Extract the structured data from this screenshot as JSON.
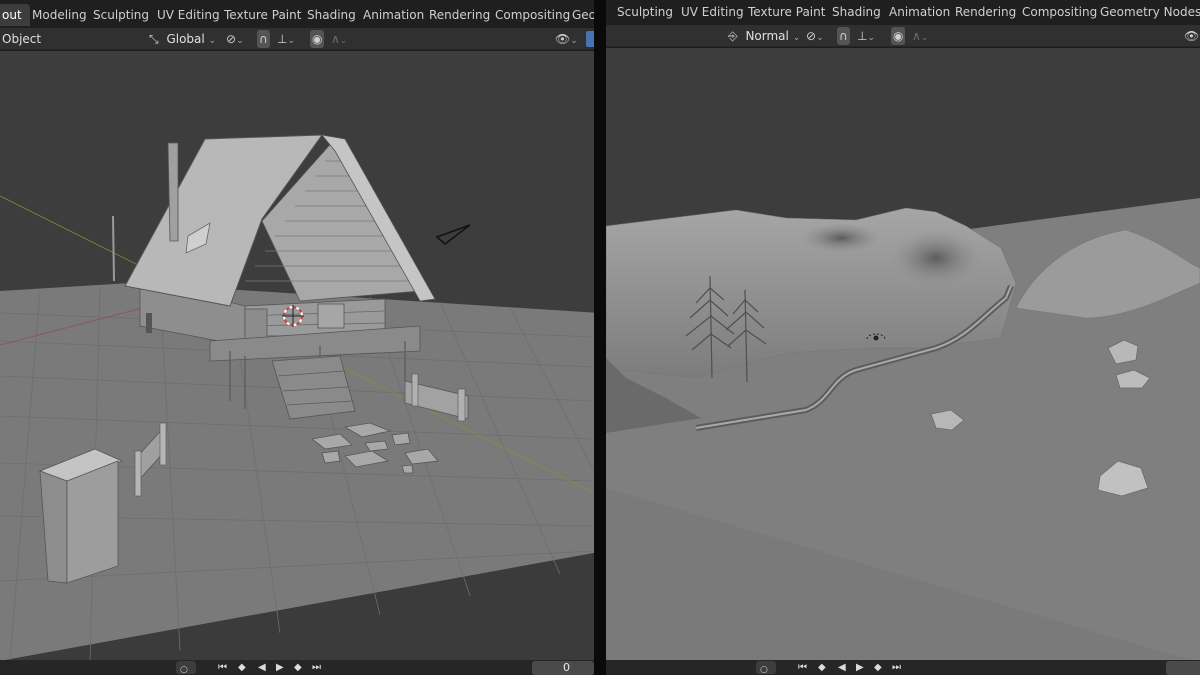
{
  "left": {
    "tabs": [
      "out",
      "Modeling",
      "Sculpting",
      "UV Editing",
      "Texture Paint",
      "Shading",
      "Animation",
      "Rendering",
      "Compositing",
      "Geo"
    ],
    "active_tab": "out",
    "header": {
      "mode_label": "Object",
      "orientation_label": "Global"
    },
    "footer": {
      "frame_value": "0"
    }
  },
  "right": {
    "tabs": [
      "Sculpting",
      "UV Editing",
      "Texture Paint",
      "Shading",
      "Animation",
      "Rendering",
      "Compositing",
      "Geometry Nodes"
    ],
    "header": {
      "orientation_label": "Normal"
    }
  },
  "icons": {
    "orientation": "transform-orientation-icon",
    "pivot": "pivot-point-icon",
    "snap": "snap-magnet-icon",
    "snap_target": "snap-increment-icon",
    "proportional": "proportional-edit-icon",
    "falloff": "falloff-curve-icon",
    "visibility": "eye-visibility-icon",
    "playback": [
      "jump-start-icon",
      "prev-keyframe-icon",
      "play-reverse-icon",
      "play-icon",
      "next-keyframe-icon",
      "jump-end-icon"
    ]
  },
  "colors": {
    "tab_bar": "#1f1f1f",
    "active_tab": "#3d3d3d",
    "header": "#303030",
    "viewport_bg": "#3d3d3d",
    "floor": "#7a7a7a",
    "axis_red": "#9b3f3f",
    "axis_green": "#6f9a3a",
    "cursor_red": "#d23c3c"
  }
}
